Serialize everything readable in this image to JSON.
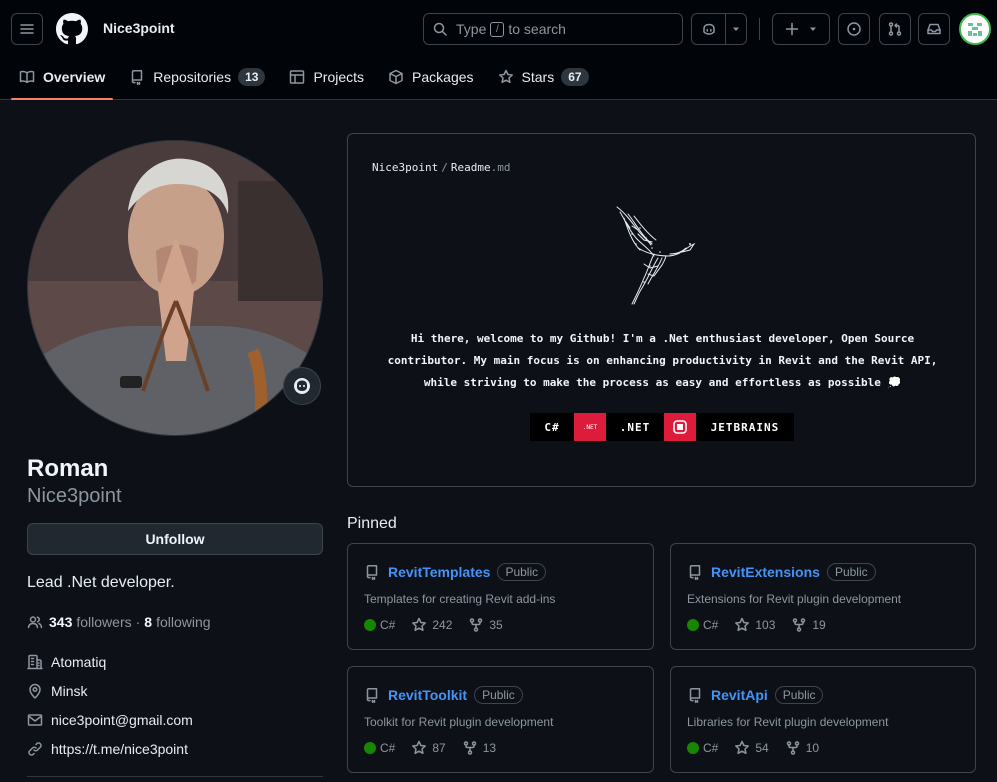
{
  "header": {
    "username": "Nice3point",
    "search": {
      "prefix": "Type",
      "key": "/",
      "suffix": "to search"
    }
  },
  "tabs": [
    {
      "label": "Overview",
      "icon": "book-icon",
      "active": true
    },
    {
      "label": "Repositories",
      "icon": "repo-icon",
      "count": "13"
    },
    {
      "label": "Projects",
      "icon": "table-icon"
    },
    {
      "label": "Packages",
      "icon": "package-icon"
    },
    {
      "label": "Stars",
      "icon": "star-icon",
      "count": "67"
    }
  ],
  "profile": {
    "full_name": "Roman",
    "login": "Nice3point",
    "unfollow_label": "Unfollow",
    "bio": "Lead .Net developer.",
    "followers_count": "343",
    "followers_label": "followers",
    "dot": "·",
    "following_count": "8",
    "following_label": "following",
    "company": "Atomatiq",
    "location": "Minsk",
    "email": "nice3point@gmail.com",
    "link": "https://t.me/nice3point"
  },
  "readme": {
    "owner": "Nice3point",
    "slash": "/",
    "file": "Readme",
    "ext": ".md",
    "text_line1": "Hi there, welcome to my Github! I'm a .Net enthusiast developer, Open Source",
    "text_line2": "contributor. My main focus is on enhancing productivity in Revit and the Revit API,",
    "text_line3": "while striving to make the process as easy and effortless as possible 💭",
    "badges": {
      "csharp": "C#",
      "net_logo": ".NET",
      "net": ".NET",
      "jetbrains": "JETBRAINS"
    },
    "accent_color": "#dd1c3c"
  },
  "pinned": {
    "title": "Pinned",
    "items": [
      {
        "name": "RevitTemplates",
        "visibility": "Public",
        "description": "Templates for creating Revit add-ins",
        "language": "C#",
        "lang_color": "#178600",
        "stars": "242",
        "forks": "35"
      },
      {
        "name": "RevitExtensions",
        "visibility": "Public",
        "description": "Extensions for Revit plugin development",
        "language": "C#",
        "lang_color": "#178600",
        "stars": "103",
        "forks": "19"
      },
      {
        "name": "RevitToolkit",
        "visibility": "Public",
        "description": "Toolkit for Revit plugin development",
        "language": "C#",
        "lang_color": "#178600",
        "stars": "87",
        "forks": "13"
      },
      {
        "name": "RevitApi",
        "visibility": "Public",
        "description": "Libraries for Revit plugin development",
        "language": "C#",
        "lang_color": "#178600",
        "stars": "54",
        "forks": "10"
      }
    ]
  }
}
